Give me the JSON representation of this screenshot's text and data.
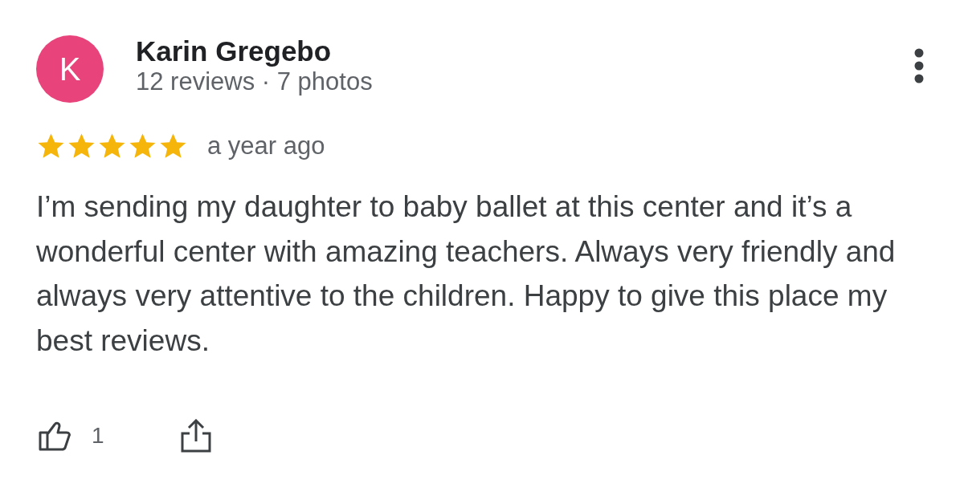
{
  "review": {
    "avatar_letter": "K",
    "name": "Karin Gregebo",
    "meta": "12 reviews · 7 photos",
    "stars": 5,
    "time": "a year ago",
    "text": "I’m sending my daughter to baby ballet at this center and it’s a wonderful center with amazing teachers. Always very friendly and always very attentive to the children. Happy to give this place my best reviews.",
    "likes": "1"
  }
}
